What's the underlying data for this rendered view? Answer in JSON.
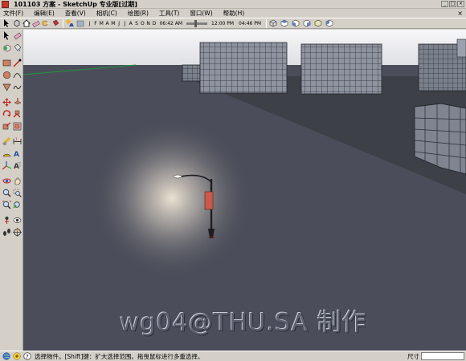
{
  "window": {
    "title": "101103 方案 - SketchUp 专业版[过期]",
    "buttons": [
      "_",
      "□",
      "×"
    ]
  },
  "menubar": {
    "items": [
      "文件(F)",
      "编辑(E)",
      "查看(V)",
      "相机(C)",
      "绘图(R)",
      "工具(T)",
      "窗口(W)",
      "帮助(H)"
    ],
    "close_glyph": "×"
  },
  "toolbar": {
    "months": [
      "J",
      "F",
      "M",
      "A",
      "M",
      "J",
      "J",
      "A",
      "S",
      "O",
      "N",
      "D"
    ],
    "sunrise_time": "06:42 AM",
    "noon_time": "12:00 PM",
    "sunset_time": "04:46 PM",
    "icons": [
      "select-icon",
      "component-icon",
      "house-icon",
      "erase-icon",
      "tape-icon",
      "paint-icon",
      "shadow-icon",
      "fog-icon",
      "iso-icon",
      "top-icon",
      "front-icon",
      "right-icon",
      "back-icon",
      "left-icon"
    ]
  },
  "palette": {
    "tools": [
      [
        "select-icon",
        "eraser-icon"
      ],
      [
        "make-component-icon",
        "paint-bucket-icon"
      ],
      [
        "rectangle-icon",
        "line-icon"
      ],
      [
        "circle-icon",
        "arc-icon"
      ],
      [
        "polygon-icon",
        "freehand-icon"
      ],
      [
        "move-icon",
        "push-pull-icon"
      ],
      [
        "rotate-icon",
        "follow-me-icon"
      ],
      [
        "scale-icon",
        "offset-icon"
      ],
      [
        "tape-measure-icon",
        "dimension-icon"
      ],
      [
        "protractor-icon",
        "text-icon"
      ],
      [
        "axes-icon",
        "3d-text-icon"
      ],
      [
        "orbit-icon",
        "pan-icon"
      ],
      [
        "zoom-icon",
        "zoom-window-icon"
      ],
      [
        "zoom-extents-icon",
        "previous-view-icon"
      ],
      [
        "position-camera-icon",
        "look-around-icon"
      ],
      [
        "walk-icon",
        "section-plane-icon"
      ]
    ]
  },
  "viewport": {
    "watermark": "wg04@THU.SA 制作"
  },
  "statusbar": {
    "hint": "选择物件。[Shift]键：扩大选择范围。拖曳鼠标进行多重选择。",
    "measure_label": "尺寸",
    "measure_value": ""
  },
  "colors": {
    "ui_gray": "#d4d0c8",
    "ground": "#4b4e5a",
    "sky": "#f4f4f6",
    "building": "#8e939f"
  }
}
